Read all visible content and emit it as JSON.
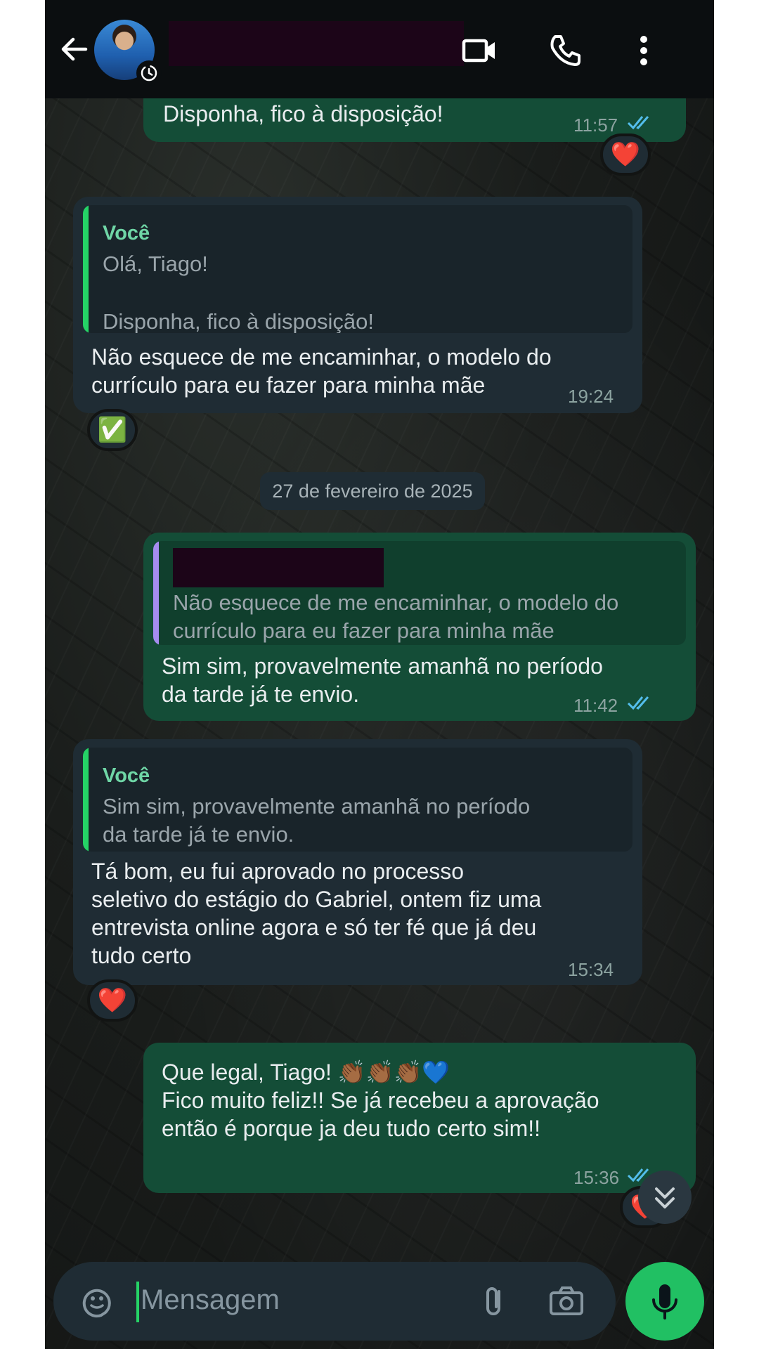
{
  "header": {
    "back_icon": "arrow-left-icon",
    "video_icon": "video-call-icon",
    "phone_icon": "phone-icon",
    "more_icon": "more-vertical-icon"
  },
  "messages": [
    {
      "text": "Disponha, fico à disposição!",
      "time": "11:57",
      "reaction": "❤️"
    },
    {
      "quote_author": "Você",
      "quote_line1": "Olá, Tiago!",
      "quote_line2": "Disponha, fico à disposição!",
      "text_line1": "Não esquece de me encaminhar, o modelo do",
      "text_line2": "currículo para eu fazer para minha mãe",
      "time": "19:24",
      "reaction": "✅"
    },
    {
      "quote_line1": "Não esquece de me encaminhar, o modelo do",
      "quote_line2": "currículo para eu fazer para minha mãe",
      "text_line1": "Sim sim, provavelmente amanhã no período",
      "text_line2": "da tarde já te envio.",
      "time": "11:42"
    },
    {
      "quote_author": "Você",
      "quote_line1": "Sim sim, provavelmente amanhã no período",
      "quote_line2": "da tarde já te envio.",
      "text_line1": "Tá bom, eu fui aprovado no processo",
      "text_line2": "seletivo do estágio do Gabriel, ontem fiz uma",
      "text_line3": "entrevista online agora e só ter fé que já deu",
      "text_line4": "tudo certo",
      "time": "15:34",
      "reaction": "❤️"
    },
    {
      "text_line1": "Que legal, Tiago! 👏🏾👏🏾👏🏾💙",
      "text_line2": "Fico muito feliz!! Se já recebeu a aprovação",
      "text_line3": "então é porque ja deu tudo certo sim!!",
      "time": "15:36",
      "reaction": "❤️"
    }
  ],
  "date_separator": "27 de fevereiro de 2025",
  "composer": {
    "placeholder": "Mensagem",
    "emoji_icon": "sticker-icon",
    "attach_icon": "paperclip-icon",
    "camera_icon": "camera-icon",
    "mic_icon": "microphone-icon"
  },
  "colors": {
    "outgoing_bubble": "#144d37",
    "incoming_bubble": "#1f2c34",
    "accent": "#21c063",
    "read_ticks": "#53bdeb"
  }
}
